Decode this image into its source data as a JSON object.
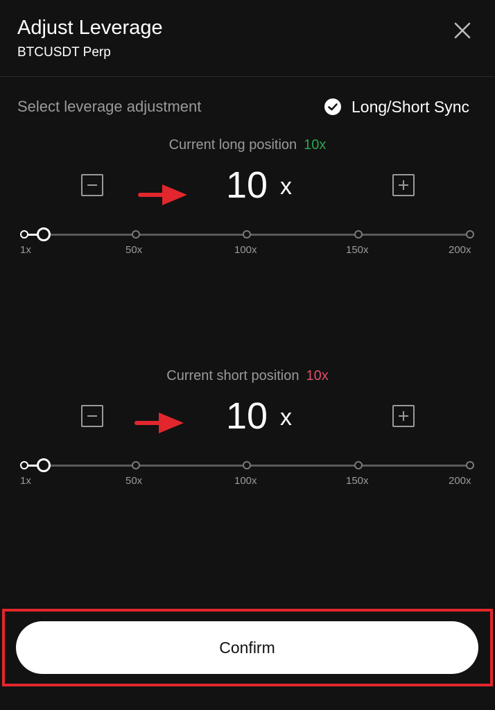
{
  "header": {
    "title": "Adjust Leverage",
    "subtitle": "BTCUSDT Perp",
    "close_icon": "close-icon"
  },
  "controls": {
    "select_label": "Select leverage adjustment",
    "sync_label": "Long/Short Sync",
    "sync_checked": true
  },
  "long": {
    "label": "Current long position",
    "current": "10x",
    "value": "10",
    "unit": "x",
    "color": "#2ea44f",
    "slider_fraction": 0.045
  },
  "short": {
    "label": "Current short position",
    "current": "10x",
    "value": "10",
    "unit": "x",
    "color": "#e0506a",
    "slider_fraction": 0.045
  },
  "slider_ticks": [
    "1x",
    "50x",
    "100x",
    "150x",
    "200x"
  ],
  "annotations": {
    "arrow_color": "#e1272d",
    "highlight_color": "#e1272d"
  },
  "footer": {
    "confirm_label": "Confirm"
  }
}
